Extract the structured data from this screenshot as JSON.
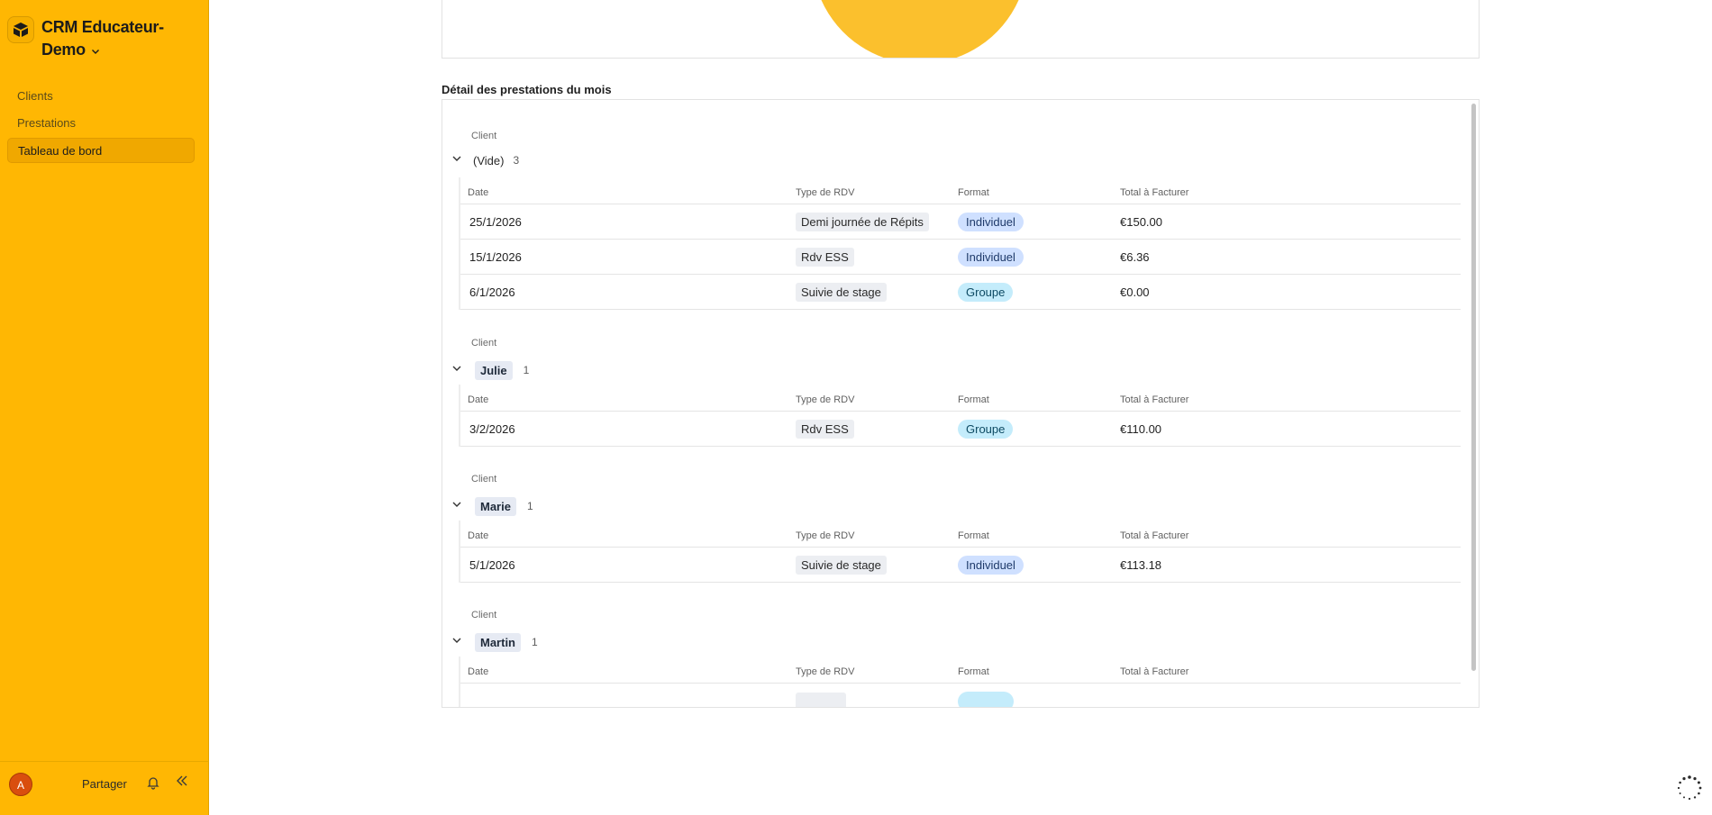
{
  "app": {
    "title": "CRM Educateur-Demo",
    "brand_color": "#ffb703"
  },
  "sidebar": {
    "items": [
      {
        "label": "Clients",
        "active": false
      },
      {
        "label": "Prestations",
        "active": false
      },
      {
        "label": "Tableau de bord",
        "active": true
      }
    ],
    "footer": {
      "avatar_initial": "A",
      "share_label": "Partager"
    }
  },
  "detail": {
    "title": "Détail des prestations du mois",
    "group_field_label": "Client",
    "columns": [
      "Date",
      "Type de RDV",
      "Format",
      "Total à Facturer"
    ],
    "groups": [
      {
        "name": "(Vide)",
        "count": "3",
        "rows": [
          {
            "date": "25/1/2026",
            "type": "Demi journée de Répits",
            "format": "Individuel",
            "total": "€150.00"
          },
          {
            "date": "15/1/2026",
            "type": "Rdv ESS",
            "format": "Individuel",
            "total": "€6.36"
          },
          {
            "date": "6/1/2026",
            "type": "Suivie de stage",
            "format": "Groupe",
            "total": "€0.00"
          }
        ]
      },
      {
        "name": "Julie",
        "count": "1",
        "rows": [
          {
            "date": "3/2/2026",
            "type": "Rdv ESS",
            "format": "Groupe",
            "total": "€110.00"
          }
        ]
      },
      {
        "name": "Marie",
        "count": "1",
        "rows": [
          {
            "date": "5/1/2026",
            "type": "Suivie de stage",
            "format": "Individuel",
            "total": "€113.18"
          }
        ]
      },
      {
        "name": "Martin",
        "count": "1",
        "rows": []
      }
    ]
  }
}
